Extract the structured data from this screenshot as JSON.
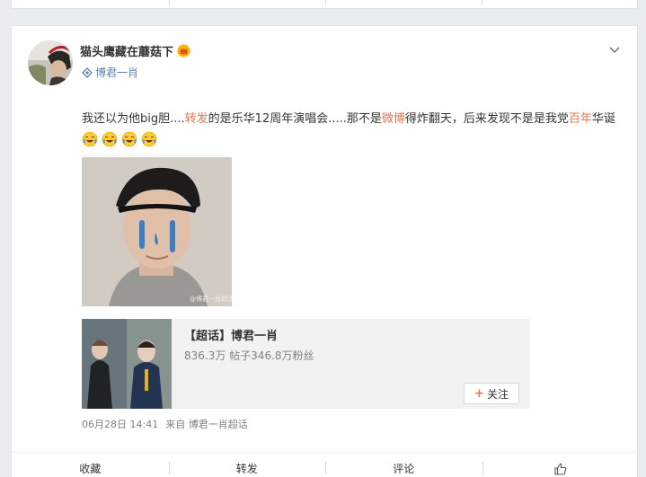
{
  "post": {
    "author": "猫头鹰藏在蘑菇下",
    "source_tag": "博君一肖",
    "text_parts": [
      {
        "text": "我还以为他big胆....",
        "hl": false
      },
      {
        "text": "转发",
        "hl": true
      },
      {
        "text": "的是乐华12周年演唱会.....那不是",
        "hl": false
      },
      {
        "text": "微博",
        "hl": true
      },
      {
        "text": "得炸翻天，后来发现不是是我党",
        "hl": false
      },
      {
        "text": "百年",
        "hl": true
      },
      {
        "text": "华诞",
        "hl": false
      }
    ],
    "emoji_icon": "laugh-cry-emoji",
    "emoji_count": 4,
    "image_watermark": "@博君一肖超话",
    "topic": {
      "title": "【超话】博君一肖",
      "stats": "836.3万 帖子346.8万粉丝",
      "follow_label": "关注"
    },
    "meta": {
      "time": "06月28日 14:41",
      "from_prefix": "来自",
      "from_source": "博君一肖超话"
    },
    "actions": {
      "favorite": "收藏",
      "repost": "转发",
      "comment": "评论"
    }
  },
  "colors": {
    "highlight": "#eb7350",
    "link": "#5b83b0",
    "meta": "#808080",
    "background": "#e9ecef"
  }
}
